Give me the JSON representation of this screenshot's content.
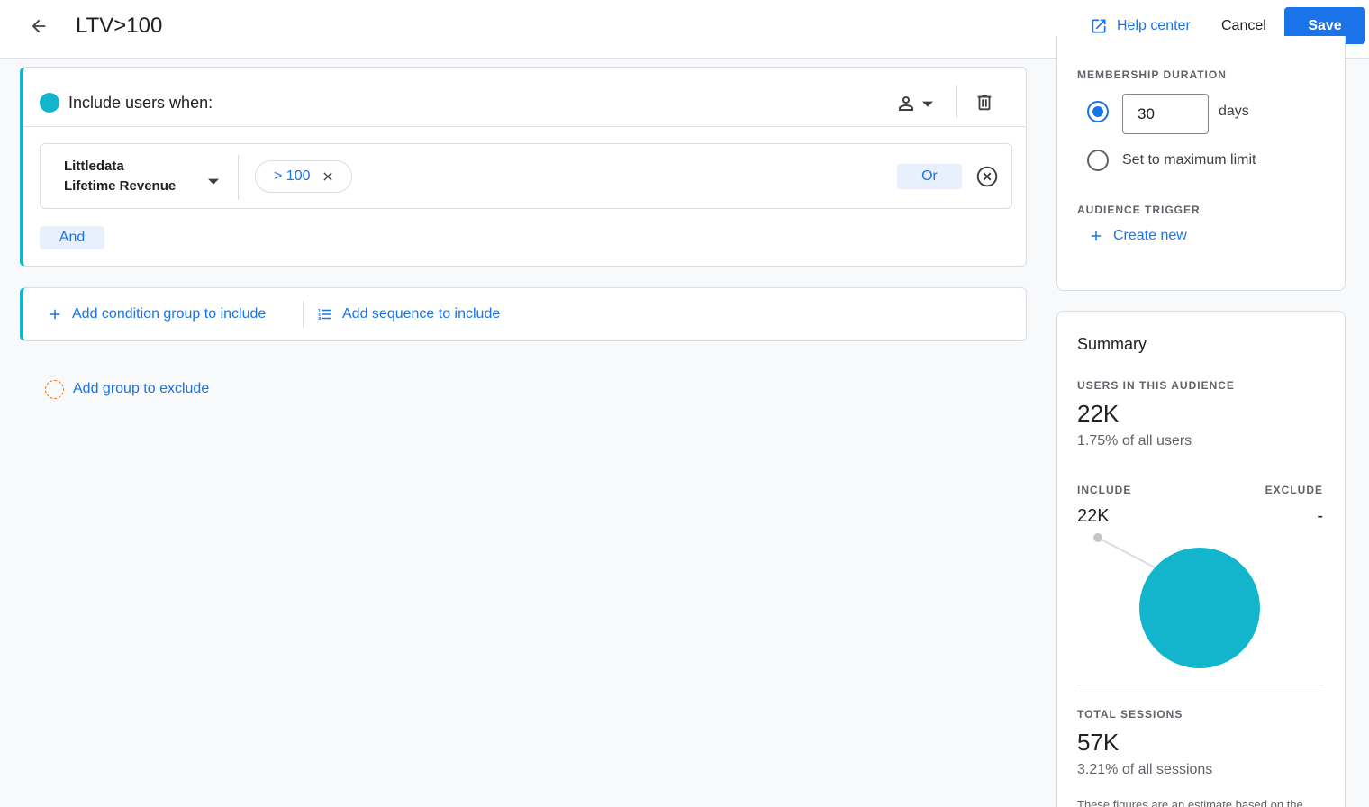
{
  "header": {
    "title": "LTV>100",
    "help_label": "Help center",
    "cancel_label": "Cancel",
    "save_label": "Save"
  },
  "include": {
    "title": "Include users when:",
    "condition": {
      "dimension_line1": "Littledata",
      "dimension_line2": "Lifetime Revenue",
      "chip_value": "> 100",
      "or_label": "Or"
    },
    "and_label": "And"
  },
  "add": {
    "condition_group_label": "Add condition group to include",
    "sequence_label": "Add sequence to include"
  },
  "exclude": {
    "label": "Add group to exclude"
  },
  "membership": {
    "heading": "MEMBERSHIP DURATION",
    "days_value": "30",
    "days_unit": "days",
    "max_limit_label": "Set to maximum limit"
  },
  "trigger": {
    "heading": "AUDIENCE TRIGGER",
    "create_label": "Create new"
  },
  "summary": {
    "title": "Summary",
    "users_heading": "USERS IN THIS AUDIENCE",
    "users_value": "22K",
    "users_pct": "1.75% of all users",
    "include_heading": "INCLUDE",
    "exclude_heading": "EXCLUDE",
    "include_value": "22K",
    "exclude_value": "-",
    "sessions_heading": "TOTAL SESSIONS",
    "sessions_value": "57K",
    "sessions_pct": "3.21% of all sessions",
    "footnote": "These figures are an estimate based on the"
  },
  "colors": {
    "accent": "#1a73e8",
    "include_teal": "#12b5cb",
    "exclude_orange": "#e8710a"
  },
  "icons": {
    "back": "arrow-left-icon",
    "help": "open-in-new-icon",
    "scope": "person-icon",
    "delete": "trash-icon",
    "remove_chip": "close-icon",
    "remove_condition": "cancel-circle-icon",
    "add": "plus-icon",
    "sequence": "list-numbered-icon"
  }
}
